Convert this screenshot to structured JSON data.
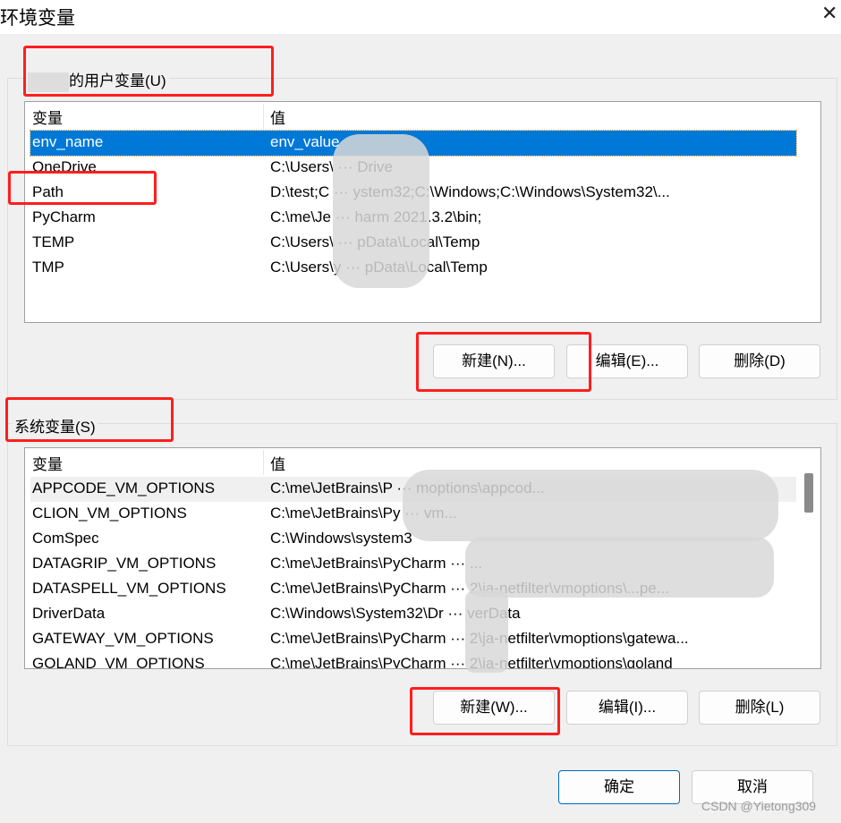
{
  "window": {
    "title": "环境变量",
    "close_icon": "close-icon"
  },
  "user_vars": {
    "group_label": "的用户变量(U)",
    "columns": [
      "变量",
      "值"
    ],
    "rows": [
      {
        "name": "env_name",
        "value": "env_value",
        "selected": true
      },
      {
        "name": "OneDrive",
        "value": "C:\\Users\\ ··· Drive"
      },
      {
        "name": "Path",
        "value": "D:\\test;C ··· ystem32;C:\\Windows;C:\\Windows\\System32\\..."
      },
      {
        "name": "PyCharm",
        "value": "C:\\me\\Je ··· harm 2021.3.2\\bin;"
      },
      {
        "name": "TEMP",
        "value": "C:\\Users\\ ··· pData\\Local\\Temp"
      },
      {
        "name": "TMP",
        "value": "C:\\Users\\y ··· pData\\Local\\Temp"
      }
    ],
    "buttons": {
      "new": "新建(N)...",
      "edit": "编辑(E)...",
      "delete": "删除(D)"
    }
  },
  "system_vars": {
    "group_label": "系统变量(S)",
    "columns": [
      "变量",
      "值"
    ],
    "rows": [
      {
        "name": "APPCODE_VM_OPTIONS",
        "value": "C:\\me\\JetBrains\\P ··· moptions\\appcod..."
      },
      {
        "name": "CLION_VM_OPTIONS",
        "value": "C:\\me\\JetBrains\\Py ··· vm..."
      },
      {
        "name": "ComSpec",
        "value": "C:\\Windows\\system3"
      },
      {
        "name": "DATAGRIP_VM_OPTIONS",
        "value": "C:\\me\\JetBrains\\PyCharm ··· ..."
      },
      {
        "name": "DATASPELL_VM_OPTIONS",
        "value": "C:\\me\\JetBrains\\PyCharm ··· 2\\ja-netfilter\\vmoptions\\...pe..."
      },
      {
        "name": "DriverData",
        "value": "C:\\Windows\\System32\\Dr ··· verData"
      },
      {
        "name": "GATEWAY_VM_OPTIONS",
        "value": "C:\\me\\JetBrains\\PyCharm ··· 2\\ja-netfilter\\vmoptions\\gatewa..."
      },
      {
        "name": "GOLAND_VM_OPTIONS",
        "value": "C:\\me\\JetBrains\\PyCharm ··· 2\\ja-netfilter\\vmoptions\\goland"
      }
    ],
    "buttons": {
      "new": "新建(W)...",
      "edit": "编辑(I)...",
      "delete": "删除(L)"
    }
  },
  "footer": {
    "ok": "确定",
    "cancel": "取消"
  },
  "watermark": "CSDN @Yietong309",
  "colors": {
    "selection": "#0078d7",
    "annotation": "#ff1e1e",
    "default_button_border": "#0067c0"
  }
}
